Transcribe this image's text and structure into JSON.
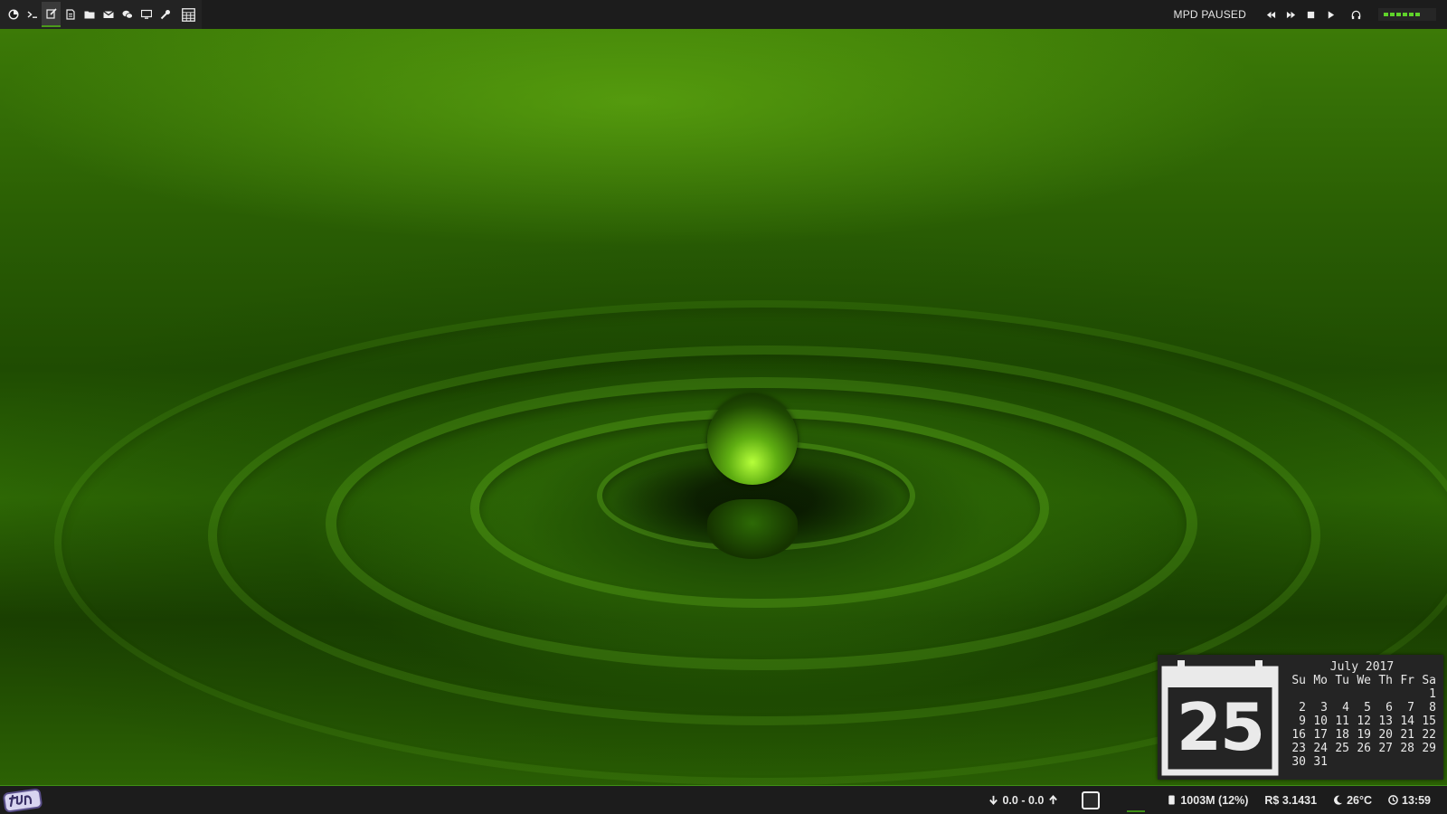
{
  "top_bar": {
    "launcher_icons": [
      {
        "name": "distro-logo-icon"
      },
      {
        "name": "terminal-icon"
      },
      {
        "name": "edit-icon"
      },
      {
        "name": "document-icon"
      },
      {
        "name": "folder-icon"
      },
      {
        "name": "mail-icon"
      },
      {
        "name": "chat-icon"
      },
      {
        "name": "monitor-icon"
      },
      {
        "name": "wrench-icon"
      },
      {
        "name": "calculator-icon"
      }
    ],
    "mpd_status": "MPD PAUSED",
    "media_controls": [
      "rewind-icon",
      "fast-forward-icon",
      "stop-icon",
      "play-icon",
      "headphones-icon"
    ],
    "volume_level": 0.7,
    "accent_color": "#5fd32a"
  },
  "calendar": {
    "day": "25",
    "month_title": "July 2017",
    "weekdays": [
      "Su",
      "Mo",
      "Tu",
      "We",
      "Th",
      "Fr",
      "Sa"
    ],
    "weeks": [
      [
        "",
        "",
        "",
        "",
        "",
        "",
        "1"
      ],
      [
        "2",
        "3",
        "4",
        "5",
        "6",
        "7",
        "8"
      ],
      [
        "9",
        "10",
        "11",
        "12",
        "13",
        "14",
        "15"
      ],
      [
        "16",
        "17",
        "18",
        "19",
        "20",
        "21",
        "22"
      ],
      [
        "23",
        "24",
        "25",
        "26",
        "27",
        "28",
        "29"
      ],
      [
        "30",
        "31",
        "",
        "",
        "",
        "",
        ""
      ]
    ]
  },
  "bottom_bar": {
    "layout_logo": "tile-layout-icon",
    "net_speed": "0.0 - 0.0",
    "memory": "1003M (12%)",
    "currency": "R$ 3.1431",
    "weather": "26°C",
    "clock": "13:59",
    "border_color": "#3f8f16"
  }
}
